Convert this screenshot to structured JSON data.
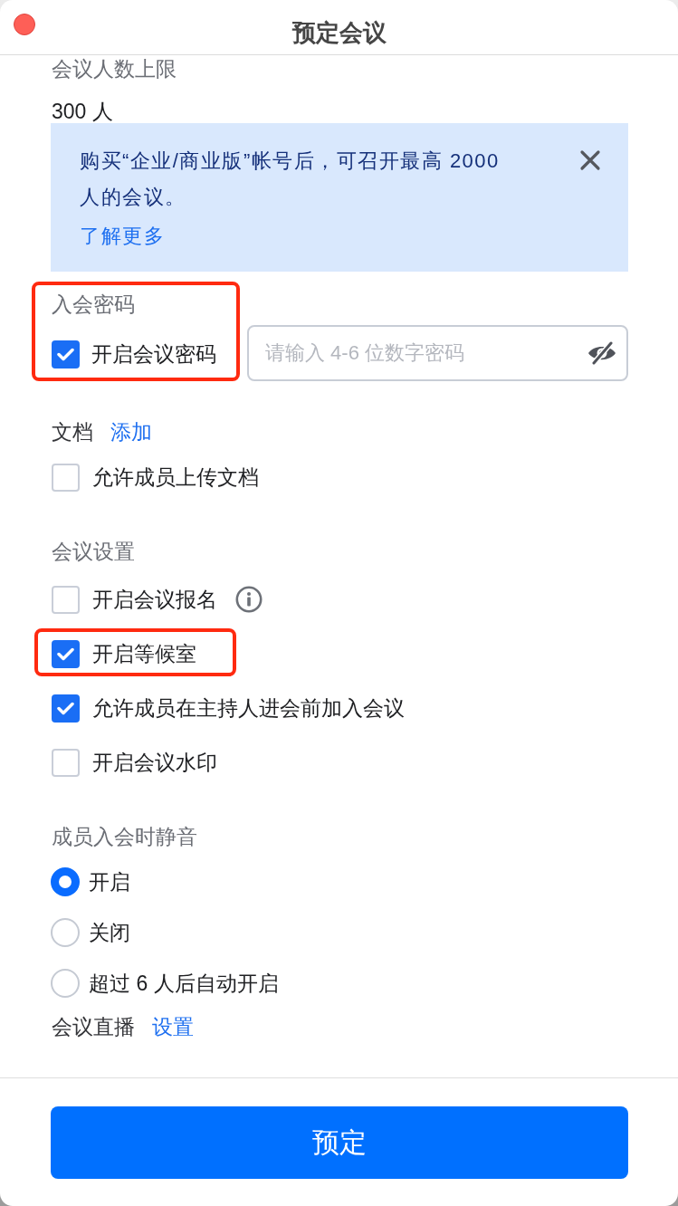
{
  "window": {
    "title": "预定会议"
  },
  "capacity": {
    "label": "会议人数上限",
    "value": "300 人"
  },
  "upgrade_banner": {
    "text": "购买“企业/商业版”帐号后，可召开最高 2000 人的会议。",
    "link": "了解更多"
  },
  "password": {
    "label": "入会密码",
    "highlighted": true,
    "enable": {
      "label": "开启会议密码",
      "checked": true
    },
    "input": {
      "placeholder": "请输入 4-6 位数字密码"
    }
  },
  "documents": {
    "label": "文档",
    "action": "添加",
    "options": [
      {
        "label": "允许成员上传文档",
        "checked": false
      }
    ]
  },
  "meeting_settings": {
    "label": "会议设置",
    "options": [
      {
        "label": "开启会议报名",
        "checked": false,
        "info": true,
        "highlighted": false
      },
      {
        "label": "开启等候室",
        "checked": true,
        "info": false,
        "highlighted": true
      },
      {
        "label": "允许成员在主持人进会前加入会议",
        "checked": true,
        "info": false,
        "highlighted": false
      },
      {
        "label": "开启会议水印",
        "checked": false,
        "info": false,
        "highlighted": false
      }
    ]
  },
  "mute_on_join": {
    "label": "成员入会时静音",
    "options": [
      {
        "label": "开启",
        "selected": true
      },
      {
        "label": "关闭",
        "selected": false
      },
      {
        "label": "超过 6 人后自动开启",
        "selected": false
      }
    ]
  },
  "live_stream": {
    "label": "会议直播",
    "action": "设置"
  },
  "footer": {
    "button": "预定"
  }
}
